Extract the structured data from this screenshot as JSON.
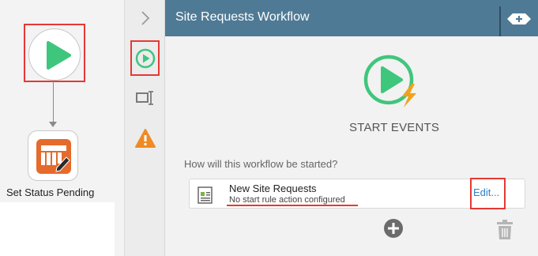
{
  "canvas": {
    "action_label": "Set Status Pending"
  },
  "toolbar": {
    "items": [
      "collapse-chevron-icon",
      "start-events-icon",
      "text-field-icon",
      "warning-icon"
    ]
  },
  "panel": {
    "title": "Site Requests Workflow",
    "section_heading": "START EVENTS",
    "question": "How will this workflow be started?",
    "rule": {
      "name": "New Site Requests",
      "status": "No start rule action configured",
      "edit_label": "Edit..."
    }
  },
  "colors": {
    "header": "#4f7a95",
    "play_green": "#3fc67d",
    "bolt_orange": "#f0a21b",
    "highlight_red": "#e53935",
    "link_blue": "#2f80c8",
    "warning_orange": "#f08a24"
  }
}
